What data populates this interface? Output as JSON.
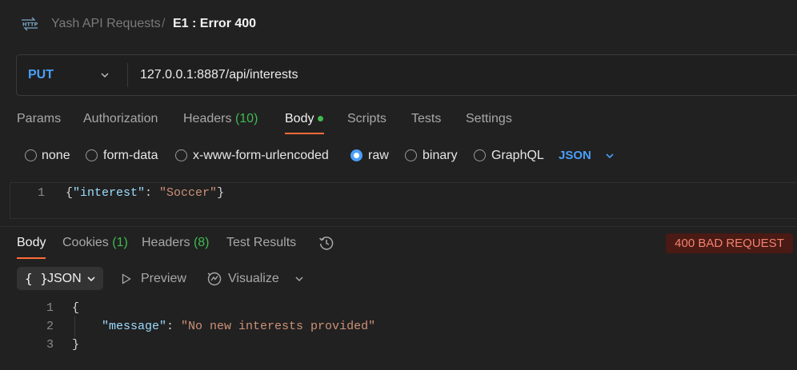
{
  "breadcrumb": {
    "icon": "http-icon",
    "collection": "Yash API Requests",
    "separator": "/",
    "current": "E1 : Error 400"
  },
  "request": {
    "method": "PUT",
    "url": "127.0.0.1:8887/api/interests"
  },
  "request_tabs": [
    {
      "label": "Params"
    },
    {
      "label": "Authorization"
    },
    {
      "label": "Headers",
      "count": "(10)"
    },
    {
      "label": "Body",
      "active": true
    },
    {
      "label": "Scripts"
    },
    {
      "label": "Tests"
    },
    {
      "label": "Settings"
    }
  ],
  "body_types": [
    {
      "label": "none",
      "checked": false
    },
    {
      "label": "form-data",
      "checked": false
    },
    {
      "label": "x-www-form-urlencoded",
      "checked": false
    },
    {
      "label": "raw",
      "checked": true
    },
    {
      "label": "binary",
      "checked": false
    },
    {
      "label": "GraphQL",
      "checked": false
    }
  ],
  "raw_format": "JSON",
  "request_body": {
    "line_number": "1",
    "open": "{",
    "key": "\"interest\"",
    "colon": ": ",
    "value": "\"Soccer\"",
    "close": "}"
  },
  "response_tabs": [
    {
      "label": "Body",
      "active": true
    },
    {
      "label": "Cookies",
      "count": "(1)"
    },
    {
      "label": "Headers",
      "count": "(8)"
    },
    {
      "label": "Test Results"
    }
  ],
  "status": "400 BAD REQUEST",
  "response_toolbar": {
    "braces": "{ }",
    "format": "JSON",
    "preview": "Preview",
    "visualize": "Visualize"
  },
  "response_body": {
    "line_numbers": [
      "1",
      "2",
      "3"
    ],
    "open": "{",
    "key": "\"message\"",
    "colon": ": ",
    "value": "\"No new interests provided\"",
    "close": "}"
  },
  "colors": {
    "background": "#212121",
    "accent": "#ff6c37",
    "method": "#4a9ff8",
    "count_green": "#3fb950",
    "status_bg": "#4a1a14",
    "status_text": "#f3826f"
  }
}
